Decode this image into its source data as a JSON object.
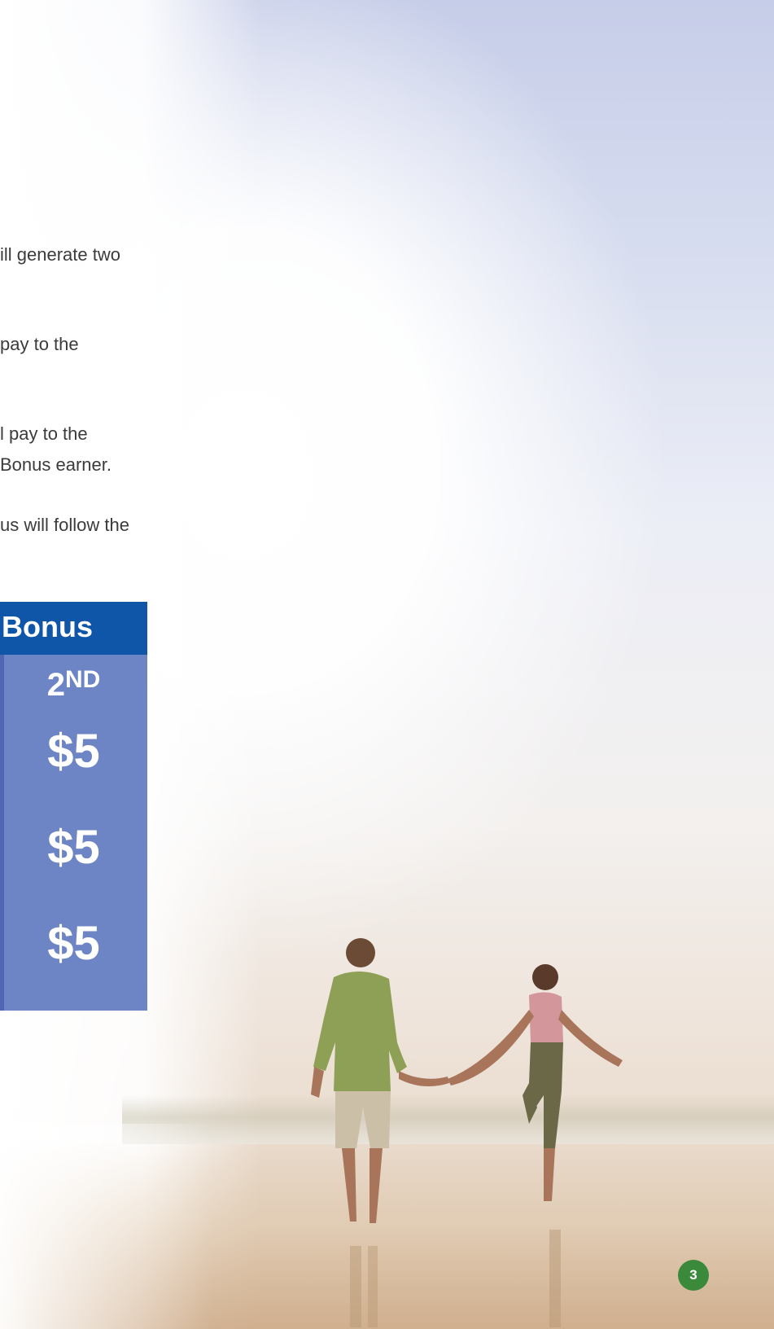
{
  "body_text": {
    "line_1": "ill generate two",
    "line_2": "pay to the",
    "line_3": "l pay to the",
    "line_4": "Bonus earner.",
    "line_5": "us will follow the"
  },
  "bonus_table": {
    "header": "Bonus",
    "rank_number": "2",
    "rank_suffix": "ND",
    "values": [
      "$5",
      "$5",
      "$5"
    ]
  },
  "colors": {
    "header_blue": "#0f55a8",
    "column_blue": "#6d84c5",
    "page_badge_green": "#3b8a3b"
  },
  "page_number": "3"
}
